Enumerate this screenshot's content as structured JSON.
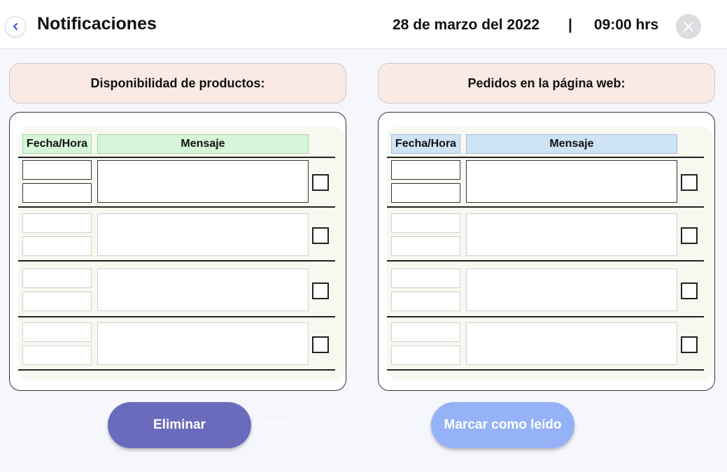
{
  "header": {
    "title": "Notificaciones",
    "date": "28 de marzo del 2022",
    "separator": "|",
    "time": "09:00 hrs",
    "back_icon": "chevron-left-icon",
    "close_icon": "close-icon"
  },
  "left_panel": {
    "title": "Disponibilidad de productos:",
    "columns": [
      "Fecha/Hora",
      "Mensaje"
    ],
    "header_color": "#d5f6d8",
    "rows": [
      {
        "date": "",
        "time": "",
        "message": "",
        "checked": false
      },
      {
        "date": "",
        "time": "",
        "message": "",
        "checked": false
      },
      {
        "date": "",
        "time": "",
        "message": "",
        "checked": false
      },
      {
        "date": "",
        "time": "",
        "message": "",
        "checked": false
      }
    ]
  },
  "right_panel": {
    "title": "Pedidos en la página web:",
    "columns": [
      "Fecha/Hora",
      "Mensaje"
    ],
    "header_color": "#cfe3f7",
    "rows": [
      {
        "date": "",
        "time": "",
        "message": "",
        "checked": false
      },
      {
        "date": "",
        "time": "",
        "message": "",
        "checked": false
      },
      {
        "date": "",
        "time": "",
        "message": "",
        "checked": false
      },
      {
        "date": "",
        "time": "",
        "message": "",
        "checked": false
      }
    ]
  },
  "actions": {
    "delete_label": "Eliminar",
    "mark_read_label": "Marcar como leído",
    "ghost_text": "e producto"
  },
  "colors": {
    "delete_button": "#6b6bbd",
    "mark_read_button": "#95b1f7",
    "panel_title_bg": "#fbeae3"
  }
}
